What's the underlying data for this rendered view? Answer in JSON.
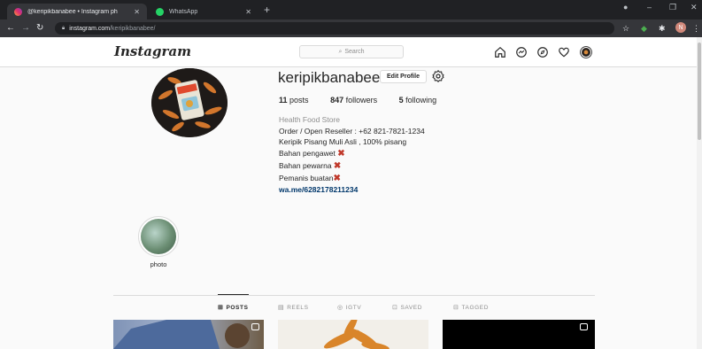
{
  "browser": {
    "tabs": [
      {
        "title": "@keripikbanabee • Instagram ph",
        "active": true
      },
      {
        "title": "WhatsApp",
        "active": false
      }
    ],
    "url_host": "instagram.com",
    "url_path": "/keripikbanabee/",
    "profile_initial": "N",
    "window_controls": [
      "–",
      "❐",
      "✕"
    ]
  },
  "ig_header": {
    "logo": "Instagram",
    "search_placeholder": "Search"
  },
  "profile": {
    "username": "keripikbanabee",
    "edit_button": "Edit Profile",
    "posts_count": "11",
    "posts_label": "posts",
    "followers_count": "847",
    "followers_label": "followers",
    "following_count": "5",
    "following_label": "following",
    "category": "Health Food Store",
    "bio_lines": [
      "Order / Open Reseller : +62 821-7821-1234",
      "Keripik Pisang Muli Asli , 100% pisang",
      "Bahan pengawet",
      "Bahan pewarna",
      "Pemanis buatan"
    ],
    "link": "wa.me/6282178211234"
  },
  "highlights": [
    {
      "label": "photo"
    }
  ],
  "profile_tabs": [
    {
      "label": "POSTS",
      "icon": "grid-icon",
      "active": true
    },
    {
      "label": "REELS",
      "icon": "reels-icon",
      "active": false
    },
    {
      "label": "IGTV",
      "icon": "igtv-icon",
      "active": false
    },
    {
      "label": "SAVED",
      "icon": "bookmark-icon",
      "active": false
    },
    {
      "label": "TAGGED",
      "icon": "tag-icon",
      "active": false
    }
  ],
  "colors": {
    "accent_link": "#00376b",
    "x_mark": "#c0392b"
  }
}
